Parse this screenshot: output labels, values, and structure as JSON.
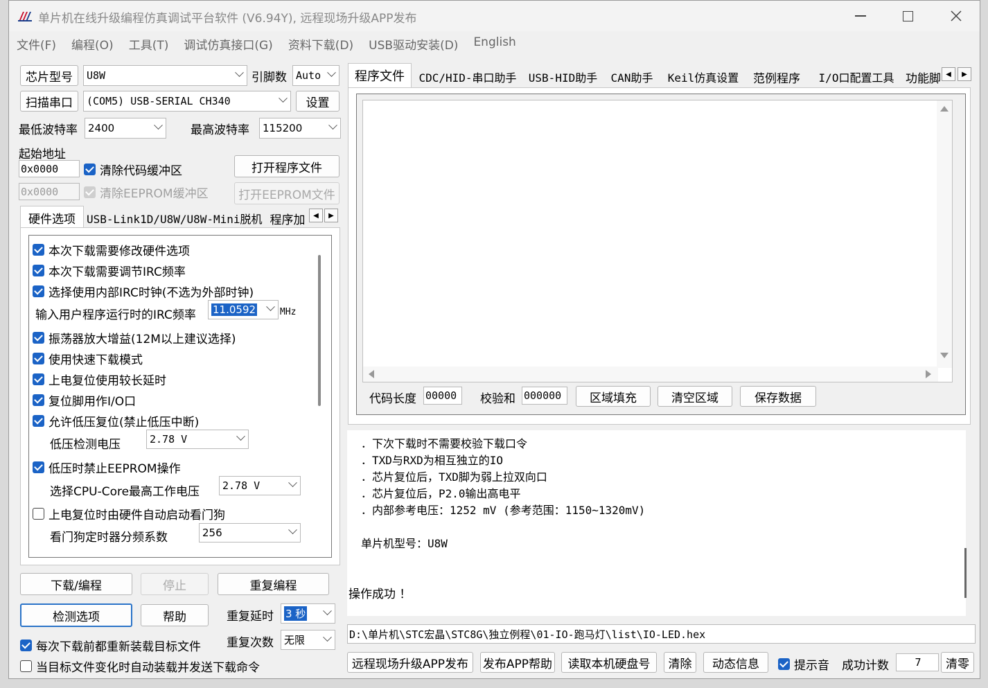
{
  "window": {
    "title": "单片机在线升级编程仿真调试平台软件 (V6.94Y), 远程现场升级APP发布",
    "icon": "stc-logo-icon"
  },
  "menu": [
    "文件(F)",
    "编程(O)",
    "工具(T)",
    "调试仿真接口(G)",
    "资料下载(D)",
    "USB驱动安装(D)",
    "English"
  ],
  "left": {
    "chip_label": "芯片型号",
    "chip_value": "U8W",
    "pin_label": "引脚数",
    "pin_value": "Auto",
    "scan_button": "扫描串口",
    "port_value": "(COM5) USB-SERIAL CH340",
    "settings_button": "设置",
    "min_baud_label": "最低波特率",
    "min_baud_value": "2400",
    "max_baud_label": "最高波特率",
    "max_baud_value": "115200",
    "start_addr_label": "起始地址",
    "code_addr": "0x0000",
    "clear_code_label": "清除代码缓冲区",
    "open_program_button": "打开程序文件",
    "eeprom_addr": "0x0000",
    "clear_eeprom_label": "清除EEPROM缓冲区",
    "open_eeprom_button": "打开EEPROM文件",
    "tabs": [
      "硬件选项",
      "USB-Link1D/U8W/U8W-Mini脱机",
      "程序加"
    ],
    "options": [
      "本次下载需要修改硬件选项",
      "本次下载需要调节IRC频率",
      "选择使用内部IRC时钟(不选为外部时钟)"
    ],
    "irc_label": "输入用户程序运行时的IRC频率",
    "irc_value": "11.0592",
    "irc_unit": "MHz",
    "options2": [
      "振荡器放大增益(12M以上建议选择)",
      "使用快速下载模式",
      "上电复位使用较长延时",
      "复位脚用作I/O口",
      "允许低压复位(禁止低压中断)"
    ],
    "lv_label": "低压检测电压",
    "lv_value": "2.78 V",
    "lv_eeprom_label": "低压时禁止EEPROM操作",
    "cpu_label": "选择CPU-Core最高工作电压",
    "cpu_value": "2.78 V",
    "wdt_auto_label": "上电复位时由硬件自动启动看门狗",
    "wdt_div_label": "看门狗定时器分频系数",
    "wdt_div_value": "256",
    "download_button": "下载/编程",
    "stop_button": "停止",
    "repeat_button": "重复编程",
    "detect_button": "检测选项",
    "help_button": "帮助",
    "repeat_delay_label": "重复延时",
    "repeat_delay_value": "3 秒",
    "repeat_count_label": "重复次数",
    "repeat_count_value": "无限",
    "reload_label": "每次下载前都重新装载目标文件",
    "auto_send_label": "当目标文件变化时自动装载并发送下载命令"
  },
  "right": {
    "tabs": [
      "程序文件",
      "CDC/HID-串口助手",
      "USB-HID助手",
      "CAN助手",
      "Keil仿真设置",
      "范例程序",
      "I/O口配置工具",
      "功能脚"
    ],
    "code_len_label": "代码长度",
    "code_len_value": "00000",
    "checksum_label": "校验和",
    "checksum_value": "000000",
    "fill_button": "区域填充",
    "clear_area_button": "清空区域",
    "save_button": "保存数据",
    "log": [
      "．下次下载时不需要校验下载口令",
      "．TXD与RXD为相互独立的IO",
      "．芯片复位后，TXD脚为弱上拉双向口",
      "．芯片复位后，P2.0输出高电平",
      "．内部参考电压：1252 mV (参考范围：1150~1320mV)"
    ],
    "chip_line": "单片机型号：U8W",
    "success_line": "操作成功 ！",
    "file_path": "D:\\单片机\\STC宏晶\\STC8G\\独立例程\\01-IO-跑马灯\\list\\IO-LED.hex",
    "bottom_buttons": [
      "远程现场升级APP发布",
      "发布APP帮助",
      "读取本机硬盘号",
      "清除",
      "动态信息"
    ],
    "sound_label": "提示音",
    "success_count_label": "成功计数",
    "success_count_value": "7",
    "zero_button": "清零"
  }
}
